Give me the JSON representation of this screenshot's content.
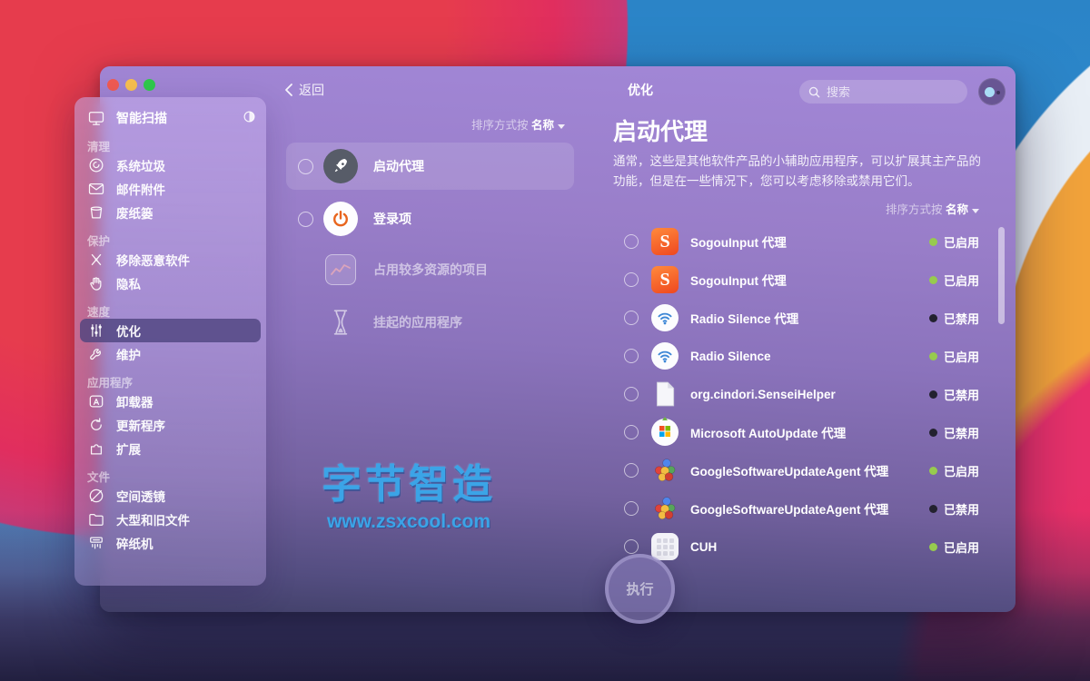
{
  "window": {
    "title": "优化",
    "back_label": "返回",
    "search_placeholder": "搜索"
  },
  "sidebar": {
    "smart_scan": {
      "label": "智能扫描",
      "icon": "smart-scan"
    },
    "groups": [
      {
        "header": "清理",
        "items": [
          {
            "label": "系统垃圾",
            "icon": "junk"
          },
          {
            "label": "邮件附件",
            "icon": "mail"
          },
          {
            "label": "废纸篓",
            "icon": "trashcan"
          }
        ]
      },
      {
        "header": "保护",
        "items": [
          {
            "label": "移除恶意软件",
            "icon": "malware"
          },
          {
            "label": "隐私",
            "icon": "privacy"
          }
        ]
      },
      {
        "header": "速度",
        "items": [
          {
            "label": "优化",
            "icon": "sliders",
            "selected": true
          },
          {
            "label": "维护",
            "icon": "wrench"
          }
        ]
      },
      {
        "header": "应用程序",
        "items": [
          {
            "label": "卸载器",
            "icon": "uninstaller"
          },
          {
            "label": "更新程序",
            "icon": "updater"
          },
          {
            "label": "扩展",
            "icon": "puzzle"
          }
        ]
      },
      {
        "header": "文件",
        "items": [
          {
            "label": "空间透镜",
            "icon": "lens"
          },
          {
            "label": "大型和旧文件",
            "icon": "folder"
          },
          {
            "label": "碎纸机",
            "icon": "shredder"
          }
        ]
      }
    ]
  },
  "middle": {
    "sort_prefix": "排序方式按",
    "sort_value": "名称",
    "items": [
      {
        "label": "启动代理",
        "icon": "rocket",
        "has_radio": true,
        "selected": true,
        "dim": false
      },
      {
        "label": "登录项",
        "icon": "power",
        "has_radio": true,
        "selected": false,
        "dim": false
      },
      {
        "label": "占用较多资源的项目",
        "icon": "chart",
        "has_radio": false,
        "selected": false,
        "dim": true
      },
      {
        "label": "挂起的应用程序",
        "icon": "hourglass",
        "has_radio": false,
        "selected": false,
        "dim": true
      }
    ]
  },
  "detail": {
    "heading": "启动代理",
    "description": "通常，这些是其他软件产品的小辅助应用程序，可以扩展其主产品的功能，但是在一些情况下，您可以考虑移除或禁用它们。",
    "sort_prefix": "排序方式按",
    "sort_value": "名称",
    "agents": [
      {
        "name": "SogouInput 代理",
        "icon": "sogou",
        "status": "已启用",
        "enabled": true
      },
      {
        "name": "SogouInput 代理",
        "icon": "sogou",
        "status": "已启用",
        "enabled": true
      },
      {
        "name": "Radio Silence 代理",
        "icon": "radio-silence",
        "status": "已禁用",
        "enabled": false
      },
      {
        "name": "Radio Silence",
        "icon": "radio-silence",
        "status": "已启用",
        "enabled": true
      },
      {
        "name": "org.cindori.SenseiHelper",
        "icon": "document",
        "status": "已禁用",
        "enabled": false
      },
      {
        "name": "Microsoft AutoUpdate 代理",
        "icon": "ms-autoupdate",
        "status": "已禁用",
        "enabled": false
      },
      {
        "name": "GoogleSoftwareUpdateAgent 代理",
        "icon": "google-update",
        "status": "已启用",
        "enabled": true
      },
      {
        "name": "GoogleSoftwareUpdateAgent 代理",
        "icon": "google-update",
        "status": "已禁用",
        "enabled": false
      },
      {
        "name": "CUH",
        "icon": "cuh",
        "status": "已启用",
        "enabled": true
      }
    ]
  },
  "footer": {
    "run_label": "执行"
  },
  "watermark": {
    "line1": "字节智造",
    "line2": "www.zsxcool.com"
  },
  "colors": {
    "enabled_dot": "#97cb4e",
    "disabled_dot": "#23222f",
    "watermark_blue": "#3ba4e7"
  }
}
